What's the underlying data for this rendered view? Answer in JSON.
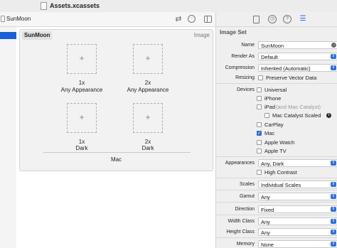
{
  "window": {
    "title": "Assets.xcassets"
  },
  "editor": {
    "filename": "SunMoon"
  },
  "asset": {
    "name": "SunMoon",
    "type": "Image",
    "slots": [
      {
        "scale": "1x",
        "appearance": "Any Appearance"
      },
      {
        "scale": "2x",
        "appearance": "Any Appearance"
      },
      {
        "scale": "1x",
        "appearance": "Dark"
      },
      {
        "scale": "2x",
        "appearance": "Dark"
      }
    ],
    "device_group": "Mac"
  },
  "icons": {
    "slot_plus": "+",
    "swap": "⇄",
    "more": "···",
    "history": "◷",
    "help": "?",
    "sliders": "☰",
    "popup_arrow": "⇕",
    "go": "→",
    "check": "✓",
    "info": "i"
  },
  "inspector": {
    "section_title": "Image Set",
    "name": {
      "label": "Name",
      "value": "SunMoon"
    },
    "render_as": {
      "label": "Render As",
      "value": "Default"
    },
    "compression": {
      "label": "Compression",
      "value": "Inherited (Automatic)"
    },
    "resizing": {
      "label": "Resizing",
      "option": "Preserve Vector Data"
    },
    "devices": {
      "label": "Devices",
      "universal": "Universal",
      "iphone": "iPhone",
      "ipad": "iPad",
      "ipad_note": "(and Mac Catalyst)",
      "mac_catalyst_scaled": "Mac Catalyst Scaled",
      "carplay": "CarPlay",
      "mac": "Mac",
      "apple_watch": "Apple Watch",
      "apple_tv": "Apple TV"
    },
    "appearances": {
      "label": "Appearances",
      "value": "Any, Dark"
    },
    "high_contrast": "High Contrast",
    "scales": {
      "label": "Scales",
      "value": "Individual Scales"
    },
    "gamut": {
      "label": "Gamut",
      "value": "Any"
    },
    "direction": {
      "label": "Direction",
      "value": "Fixed"
    },
    "width_class": {
      "label": "Width Class",
      "value": "Any"
    },
    "height_class": {
      "label": "Height Class",
      "value": "Any"
    },
    "memory": {
      "label": "Memory",
      "value": "None"
    }
  }
}
